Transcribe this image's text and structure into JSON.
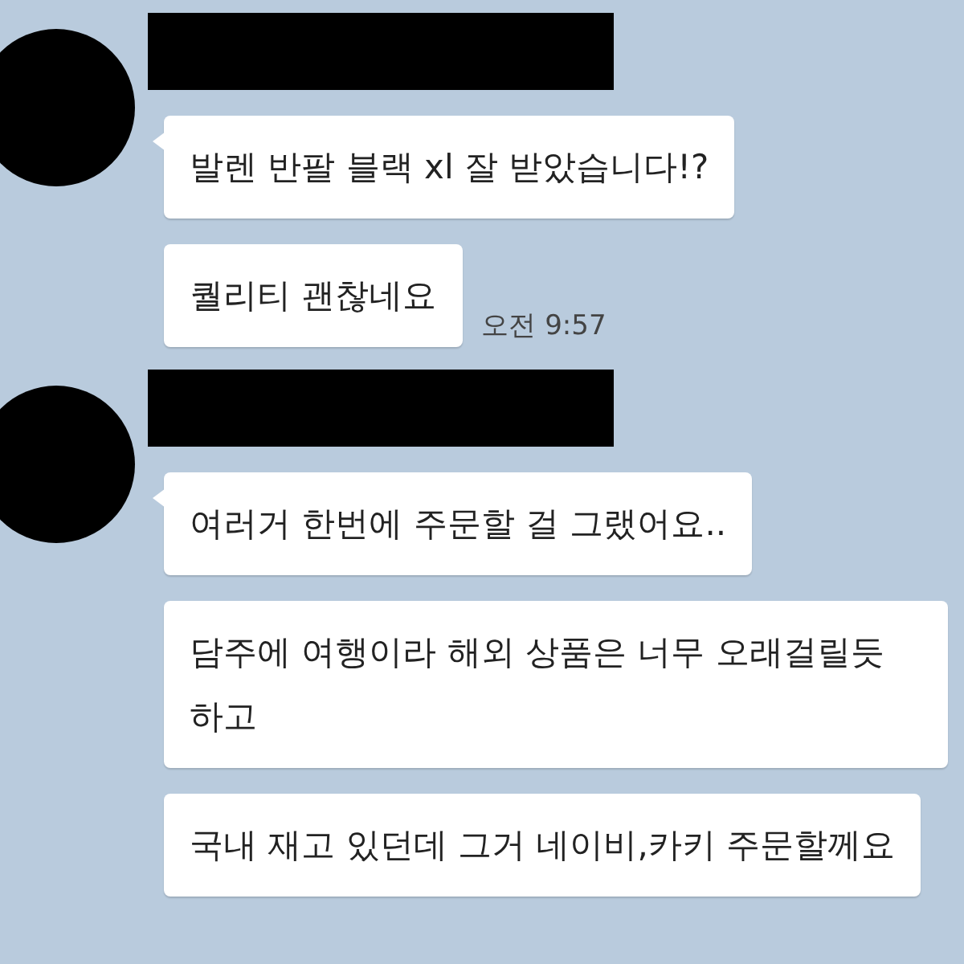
{
  "groups": [
    {
      "messages": [
        "발렌 반팔 블랙 xl 잘 받았습니다!?",
        "퀄리티 괜찮네요"
      ],
      "time": "오전 9:57"
    },
    {
      "messages": [
        "여러거 한번에 주문할 걸 그랬어요..",
        "담주에 여행이라 해외 상품은 너무 오래걸릴듯 하고",
        "국내 재고 있던데 그거 네이비,카키 주문할께요"
      ]
    }
  ]
}
